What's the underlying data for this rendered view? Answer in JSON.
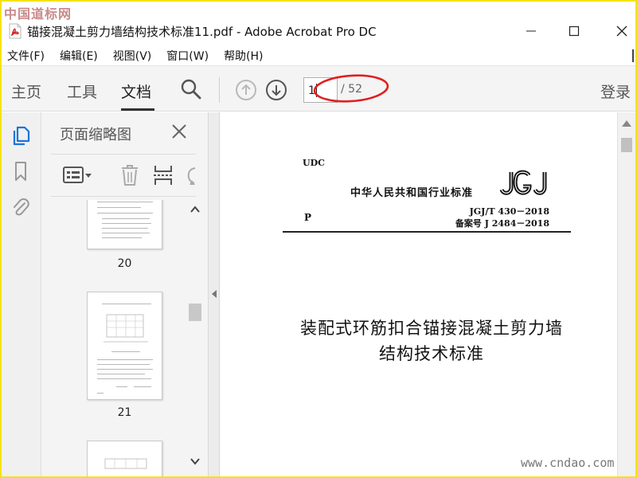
{
  "watermark": {
    "top": "中国道标网",
    "bottom": "www.cndao.com"
  },
  "window": {
    "title": "锚接混凝土剪力墙结构技术标准11.pdf - Adobe Acrobat Pro DC"
  },
  "menu": [
    "文件(F)",
    "编辑(E)",
    "视图(V)",
    "窗口(W)",
    "帮助(H)"
  ],
  "toolbar": {
    "tabs": {
      "home": "主页",
      "tools": "工具",
      "document": "文档"
    },
    "page_current": "1",
    "page_total": "/ 52",
    "login": "登录"
  },
  "thumbnails": {
    "panel_title": "页面缩略图",
    "pages": [
      "20",
      "21"
    ]
  },
  "document": {
    "udc": "UDC",
    "category": "中华人民共和国行业标准",
    "logo_text": "JGJ",
    "p_label": "P",
    "std_number": "JGJ/T 430－2018",
    "record_number": "备案号 J 2484－2018",
    "title_line1": "装配式环筋扣合锚接混凝土剪力墙",
    "title_line2": "结构技术标准"
  },
  "colors": {
    "frame_border": "#f5e30a",
    "highlight_ellipse": "#e02020",
    "pdf_icon": "#d71f1f",
    "active_rail_icon": "#1a73d9"
  },
  "icons": [
    "pdf-file-icon",
    "search-icon",
    "arrow-up-circle-icon",
    "arrow-down-circle-icon",
    "pages-icon",
    "bookmark-icon",
    "paperclip-icon",
    "close-icon",
    "thumbnail-options-icon",
    "trash-icon",
    "extract-pages-icon",
    "rotate-icon",
    "chevron-up-icon",
    "chevron-down-icon",
    "chevron-left-icon"
  ]
}
